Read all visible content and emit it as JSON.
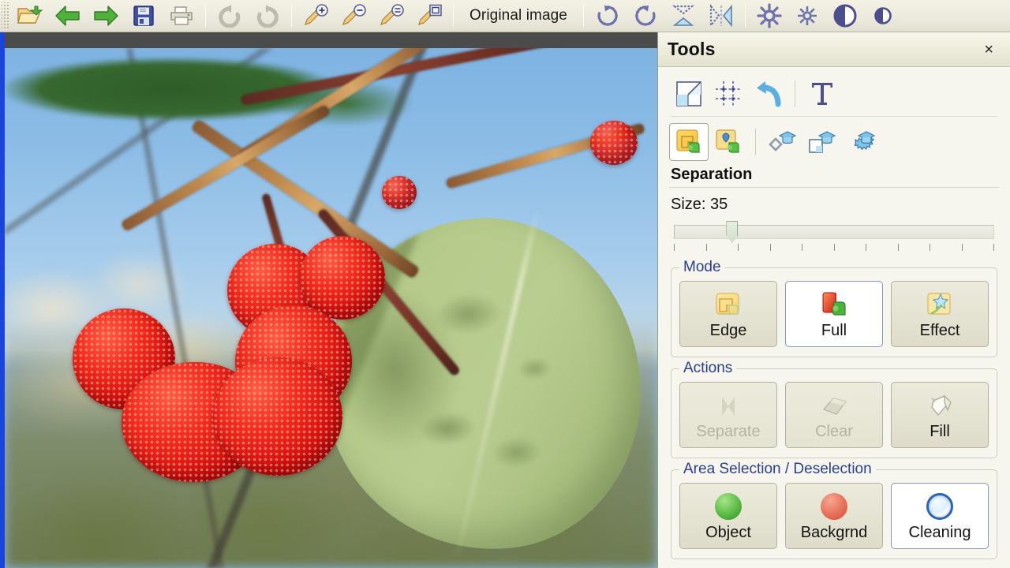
{
  "toolbar": {
    "buttons": [
      {
        "name": "open-file-icon",
        "label": "Open",
        "enabled": true
      },
      {
        "name": "arrow-left-icon",
        "label": "Previous",
        "enabled": true
      },
      {
        "name": "arrow-right-icon",
        "label": "Next",
        "enabled": true
      },
      {
        "name": "save-icon",
        "label": "Save",
        "enabled": true
      },
      {
        "name": "print-icon",
        "label": "Print",
        "enabled": true
      },
      {
        "name": "undo-icon",
        "label": "Undo",
        "enabled": false
      },
      {
        "name": "redo-icon",
        "label": "Redo",
        "enabled": false
      },
      {
        "name": "zoom-in-icon",
        "label": "Zoom In",
        "enabled": true
      },
      {
        "name": "zoom-out-icon",
        "label": "Zoom Out",
        "enabled": true
      },
      {
        "name": "zoom-fit-icon",
        "label": "Zoom Fit",
        "enabled": true
      },
      {
        "name": "zoom-actual-icon",
        "label": "Actual Size",
        "enabled": true
      },
      {
        "name": "rotate-cw-icon",
        "label": "Rotate Right",
        "enabled": true
      },
      {
        "name": "rotate-ccw-icon",
        "label": "Rotate Left",
        "enabled": true
      },
      {
        "name": "flip-vertical-icon",
        "label": "Flip Vertical",
        "enabled": true
      },
      {
        "name": "flip-horizontal-icon",
        "label": "Flip Horizontal",
        "enabled": true
      },
      {
        "name": "brightness-icon",
        "label": "Brightness",
        "enabled": true
      },
      {
        "name": "brightness-fine-icon",
        "label": "Brightness Fine",
        "enabled": true
      },
      {
        "name": "contrast-icon",
        "label": "Contrast",
        "enabled": true
      },
      {
        "name": "contrast-fine-icon",
        "label": "Contrast Fine",
        "enabled": true
      }
    ],
    "original_image_label": "Original image"
  },
  "canvas": {
    "image_description": "Close-up photograph of red strawberry-tree (Arbutus) berries hanging from brown branches, with a large pale green leaf at right and blurred blue sky and foliage in the background",
    "border_color": "#1b44dd",
    "background_color": "#4b4b4b"
  },
  "panel": {
    "title": "Tools",
    "close_label": "×",
    "tool_row_1": [
      {
        "name": "perspective-tool-icon",
        "label": "Perspective",
        "selected": false
      },
      {
        "name": "crop-grid-tool-icon",
        "label": "Crop",
        "selected": false
      },
      {
        "name": "undo-arrow-tool-icon",
        "label": "Undo",
        "selected": false
      },
      {
        "name": "text-tool-icon",
        "label": "Text",
        "selected": false
      }
    ],
    "tool_row_2": [
      {
        "name": "separation-tool-icon",
        "label": "Separation",
        "selected": true
      },
      {
        "name": "object-marker-tool-icon",
        "label": "Object Marker",
        "selected": false
      },
      {
        "name": "cap-clear-tool-icon",
        "label": "Clear Training",
        "selected": false
      },
      {
        "name": "cap-learn-tool-icon",
        "label": "Learn",
        "selected": false
      },
      {
        "name": "cap-auto-tool-icon",
        "label": "Auto Learn",
        "selected": false
      }
    ],
    "separation": {
      "heading": "Separation",
      "size_label": "Size: 35",
      "size_value": 35,
      "slider_min": 0,
      "slider_max": 200,
      "slider_percent": 18,
      "tick_count": 11
    },
    "mode": {
      "legend": "Mode",
      "buttons": [
        {
          "name": "mode-edge-button",
          "label": "Edge",
          "icon": "edge-puzzle-icon",
          "selected": false,
          "enabled": true
        },
        {
          "name": "mode-full-button",
          "label": "Full",
          "icon": "full-puzzle-icon",
          "selected": true,
          "enabled": true
        },
        {
          "name": "mode-effect-button",
          "label": "Effect",
          "icon": "effect-sparkle-icon",
          "selected": false,
          "enabled": true
        }
      ]
    },
    "actions": {
      "legend": "Actions",
      "buttons": [
        {
          "name": "separate-button",
          "label": "Separate",
          "icon": "lightning-icon",
          "selected": false,
          "enabled": false
        },
        {
          "name": "clear-button",
          "label": "Clear",
          "icon": "eraser-icon",
          "selected": false,
          "enabled": false
        },
        {
          "name": "fill-button",
          "label": "Fill",
          "icon": "paint-bucket-icon",
          "selected": false,
          "enabled": true
        }
      ]
    },
    "area_selection": {
      "legend": "Area Selection / Deselection",
      "buttons": [
        {
          "name": "object-select-button",
          "label": "Object",
          "icon": "green-circle-icon",
          "selected": false,
          "enabled": true
        },
        {
          "name": "background-select-button",
          "label": "Backgrnd",
          "icon": "red-circle-icon",
          "selected": false,
          "enabled": true
        },
        {
          "name": "cleaning-select-button",
          "label": "Cleaning",
          "icon": "blue-ring-icon",
          "selected": true,
          "enabled": true
        }
      ]
    }
  },
  "colors": {
    "toolbar_bg": "#eceade",
    "panel_bg": "#f6f5ee",
    "legend_text": "#2b3f8c",
    "selected_button_bg": "#ffffff",
    "disabled_text": "#b5b3a0",
    "canvas_border": "#1b44dd"
  }
}
